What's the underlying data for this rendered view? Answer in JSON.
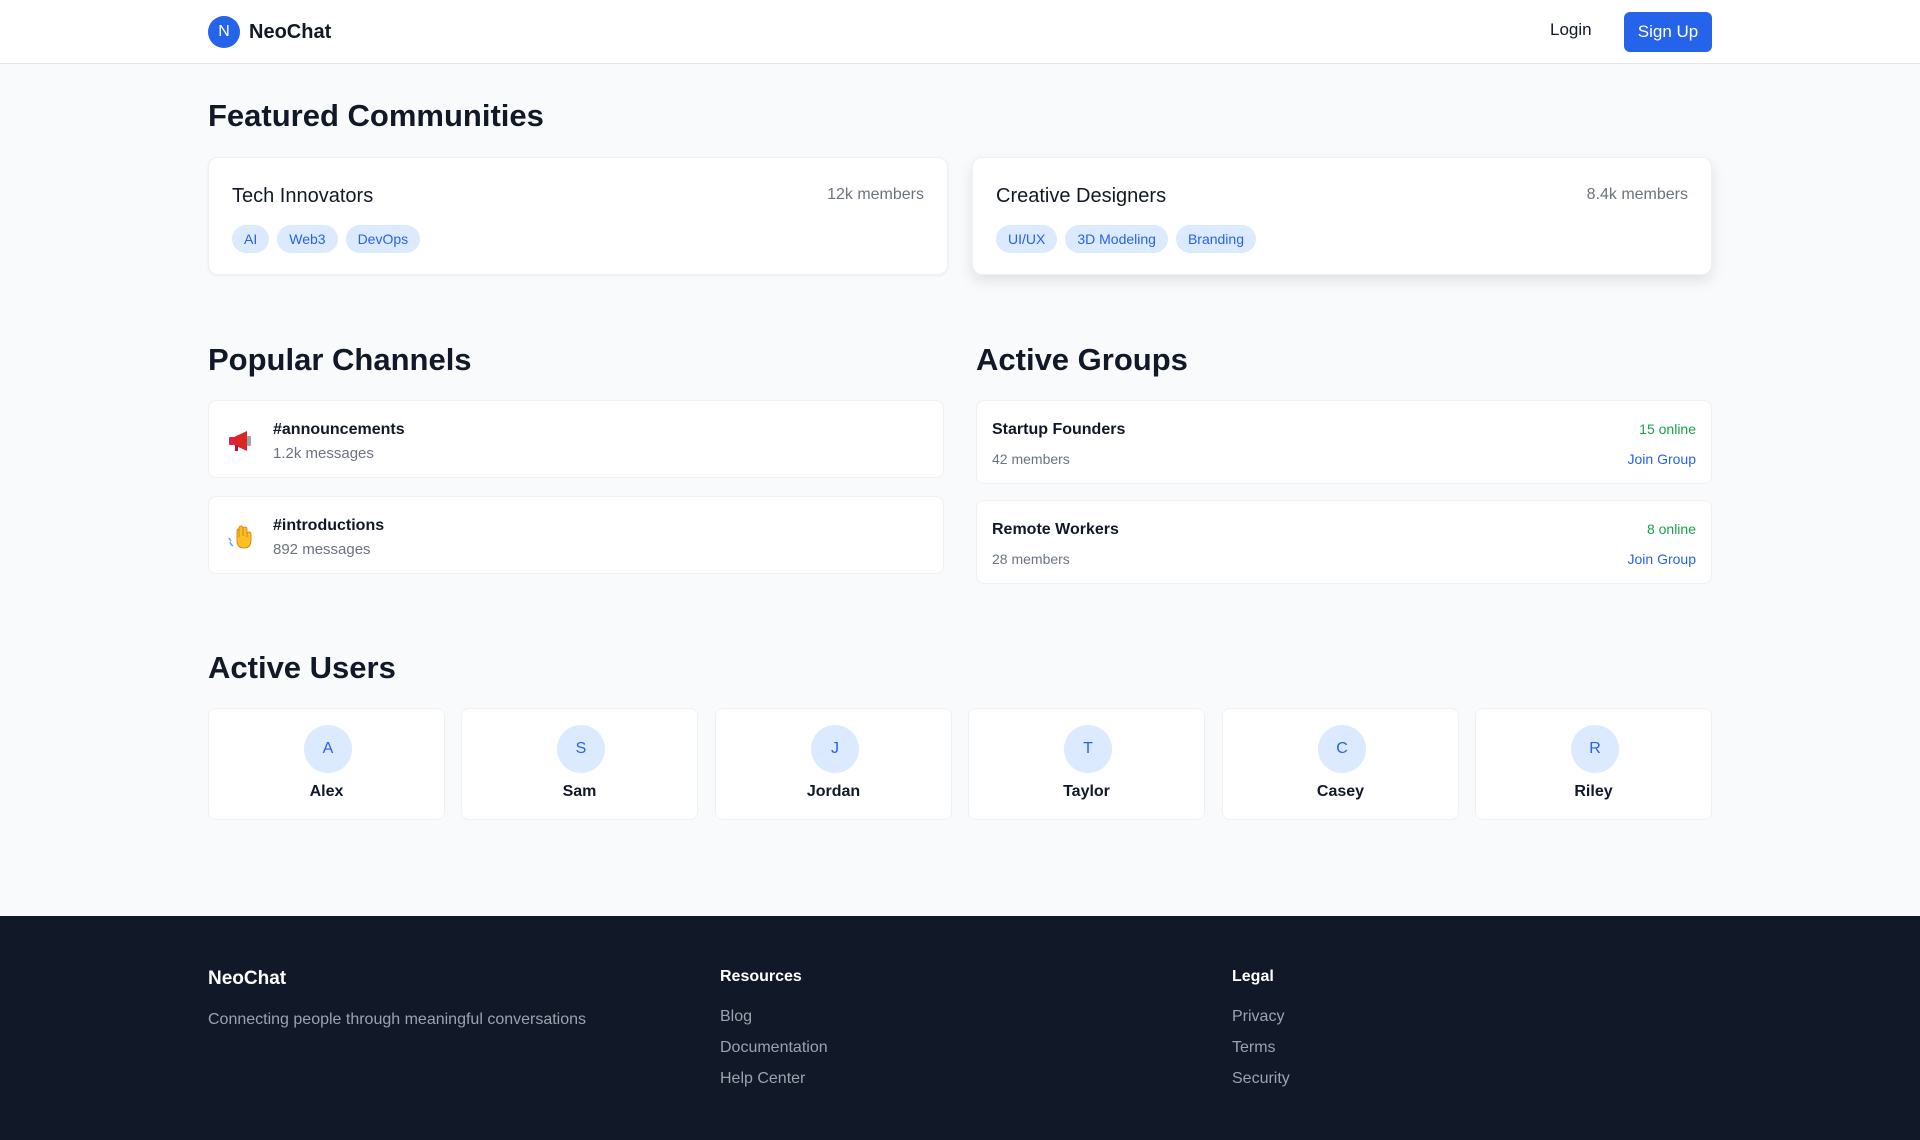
{
  "header": {
    "logo_letter": "N",
    "brand": "NeoChat",
    "login": "Login",
    "signup": "Sign Up"
  },
  "featured": {
    "title": "Featured Communities",
    "communities": [
      {
        "name": "Tech Innovators",
        "members": "12k members",
        "tags": [
          "AI",
          "Web3",
          "DevOps"
        ]
      },
      {
        "name": "Creative Designers",
        "members": "8.4k members",
        "tags": [
          "UI/UX",
          "3D Modeling",
          "Branding"
        ]
      }
    ]
  },
  "channels": {
    "title": "Popular Channels",
    "items": [
      {
        "icon": "megaphone-icon",
        "name": "#announcements",
        "count": "1.2k messages"
      },
      {
        "icon": "waving-hand-icon",
        "name": "#introductions",
        "count": "892 messages"
      }
    ]
  },
  "groups": {
    "title": "Active Groups",
    "items": [
      {
        "name": "Startup Founders",
        "members": "42 members",
        "online": "15 online",
        "join": "Join Group"
      },
      {
        "name": "Remote Workers",
        "members": "28 members",
        "online": "8 online",
        "join": "Join Group"
      }
    ]
  },
  "users": {
    "title": "Active Users",
    "items": [
      {
        "initial": "A",
        "name": "Alex"
      },
      {
        "initial": "S",
        "name": "Sam"
      },
      {
        "initial": "J",
        "name": "Jordan"
      },
      {
        "initial": "T",
        "name": "Taylor"
      },
      {
        "initial": "C",
        "name": "Casey"
      },
      {
        "initial": "R",
        "name": "Riley"
      }
    ]
  },
  "footer": {
    "brand": "NeoChat",
    "tagline": "Connecting people through meaningful conversations",
    "resources": {
      "title": "Resources",
      "links": [
        "Blog",
        "Documentation",
        "Help Center"
      ]
    },
    "legal": {
      "title": "Legal",
      "links": [
        "Privacy",
        "Terms",
        "Security"
      ]
    }
  },
  "colors": {
    "accent": "#2563eb",
    "online": "#16a34a",
    "tag_bg": "#dbeafe",
    "footer_bg": "#111827",
    "page_bg": "#f8fafc"
  }
}
